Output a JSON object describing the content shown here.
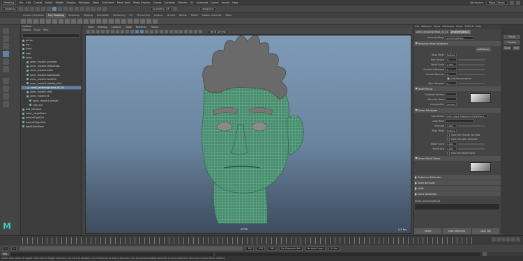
{
  "menubar": {
    "items": [
      "Modeling",
      "File",
      "Edit",
      "Create",
      "Select",
      "Modify",
      "Display",
      "Windows",
      "Mesh",
      "Edit Mesh",
      "Mesh Tools",
      "Mesh Display",
      "Curves",
      "Surfaces",
      "Deform",
      "UV",
      "Generate",
      "Cache",
      "Arnold",
      "Help"
    ],
    "workspace_label": "Workspace:",
    "workspace_value": "Maya Classic"
  },
  "statusline": {
    "mode": "Modeling",
    "symmetry": "Symmetry: Off",
    "user": "zomgfoxm"
  },
  "shelf_tabs": [
    "Curves / Surfaces",
    "Poly Modeling",
    "Sculpting",
    "Rigging",
    "Animation",
    "Rendering",
    "FX",
    "FX Caching",
    "Custom",
    "Arnold",
    "Bifrost",
    "MASH",
    "Motion Graphics",
    "XGen"
  ],
  "outliner": {
    "title": "Outliner",
    "menu": [
      "Display",
      "Show",
      "Help"
    ],
    "rows": [
      "persp",
      "top",
      "front",
      "side",
      "zomc",
      "zomc_model1:persebb",
      "zomc_model1:defaultobs",
      "zomc_model1:elbm",
      "zomc_model1:loweboties",
      "zomc_model1:leaPebli",
      "zomc_model1:dewtet_shirt",
      "zomc_lendwing:Head_01_01",
      "zomc_model1:defs",
      "zomc_model1:tk",
      "zomc_model1:lpfmab",
      "Lips_ctrl",
      "Ikat_hdtmpst",
      "zomc_ratgeToiars",
      "defaultLightSet",
      "defaultObjectSet",
      "lightEditorBase"
    ],
    "selected_index": 11
  },
  "viewport": {
    "menu": [
      "View",
      "Shading",
      "Lighting",
      "Show",
      "Renderer",
      "Panels"
    ],
    "camera_label": "persp",
    "fps": "0.2 fps"
  },
  "attribute_editor": {
    "tabs": [
      "List",
      "Selected",
      "Focus",
      "Attributes",
      "Show",
      "TURTLE",
      "Help"
    ],
    "node_tabs": [
      "zomc_lendwing:Head_01_01",
      "proximityWrap1"
    ],
    "node_label": "proximityWrap:",
    "node_value": "proximityWrap1",
    "focus_button": "Focus",
    "presets_button": "Presets",
    "show_button": "Show",
    "hide_button": "Hide",
    "sec_proximity": "Proximity Wrap Attributes",
    "add_driver_button": "Add Driver",
    "wrap_mode_label": "Wrap Mode",
    "wrap_mode_value": "Surface",
    "max_drivers_label": "Max Drivers",
    "max_drivers_value": "3",
    "falloff_scale_label": "Falloff Scale",
    "falloff_scale_value": "1.000",
    "smooth_influences_label": "Smooth Influences",
    "smooth_influences_value": "0",
    "smooth_normals_label": "Smooth Normals",
    "smooth_normals_value": "0",
    "soft_normalization_label": "Soft Normalization",
    "spanSamples_label": "Span Samples",
    "spanSamples_value": "2",
    "sec_falloff": "Falloff Ramp",
    "falloff_position_label": "Selected Position",
    "falloff_value_label": "Selected Value",
    "interpolation_label": "Interpolation",
    "interpolation_value": "Smooth",
    "sec_driver": "Driver Attributes",
    "cage_mesh_label": "Cap Drivers",
    "cage_mesh_value": "zomc_lego1:Shape proximityWrap1",
    "cage_type_label": "Cage Mesh",
    "strength_label": "Strength",
    "strength_value": "1.000",
    "smoothnessRadius_label": "Wrap Mode",
    "smoothnessRadius_value": "Surface",
    "override_smooth_label": "Override Smooth Normals",
    "override_spans_label": "Override Span Samples",
    "falloff_scale2_label": "Falloff Scale",
    "falloff_scale2_value": "1.000",
    "falloff_end_label": "Falloff End",
    "falloff_end_value": "1.000",
    "override_falloff_label": "Override Falloff Ramp",
    "sec_driver_ramp": "Driver Falloff Ramp",
    "closed_sections": [
      "Deformer Attributes",
      "Node Behavior",
      "UUID",
      "Extra Attributes"
    ],
    "notes_label": "Notes: proximityWrap1",
    "bottom_buttons": [
      "Select",
      "Load Attributes",
      "Copy Tab"
    ]
  },
  "rstrip": {
    "buttons": [
      "Focus",
      "Presets",
      "Show",
      "Hide"
    ]
  },
  "range": {
    "start": "1",
    "start2": "1",
    "end": "120",
    "end2": "120",
    "end3": "200",
    "character_set": "No Character Set",
    "anim_layer": "No Anim Layer",
    "fps": "24 fps"
  },
  "cmd": {
    "mel": "MEL"
  },
  "help_text": "Select Tool: select an object. Shift-click to toggle selection. Ctrl-click to deselect. Ctrl+Shift-click to add to selection. Use the proximityWrap deformer to drive geometry with one or more driver meshes."
}
